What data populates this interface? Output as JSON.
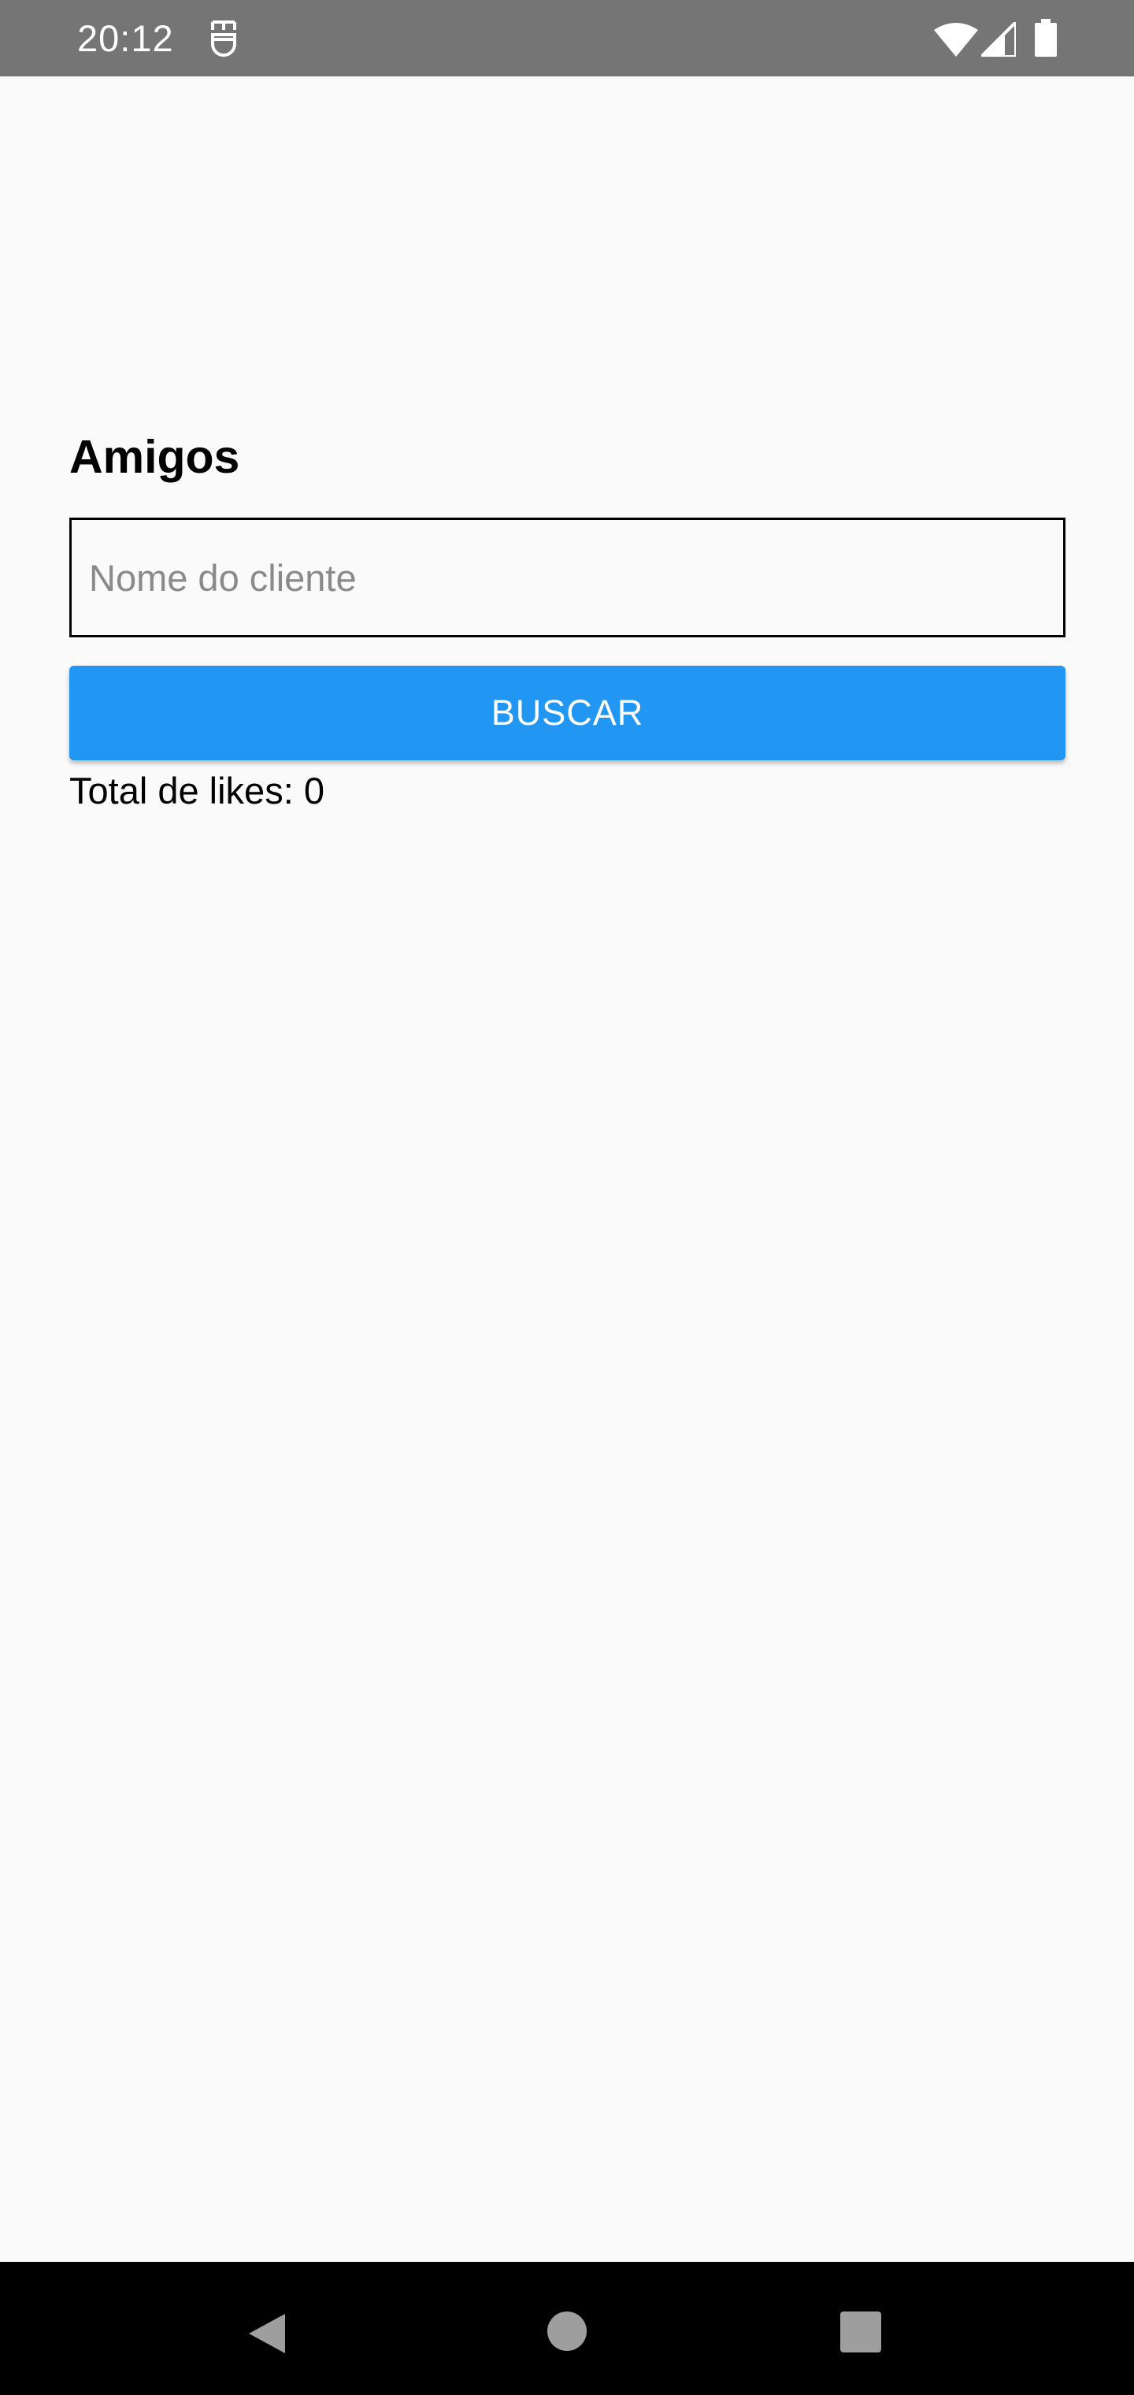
{
  "status_bar": {
    "time": "20:12",
    "icons": [
      "notification-icon",
      "wifi-icon",
      "signal-icon",
      "battery-icon"
    ]
  },
  "main": {
    "title": "Amigos",
    "search": {
      "value": "",
      "placeholder": "Nome do cliente"
    },
    "button_label": "BUSCAR",
    "likes_label": "Total de likes: ",
    "likes_count": "0"
  },
  "nav_bar": {
    "icons": [
      "back-icon",
      "home-icon",
      "recents-icon"
    ]
  },
  "colors": {
    "status_bar": "#757575",
    "background": "#fafafa",
    "button": "#2196f3",
    "nav_bar": "#000000"
  }
}
